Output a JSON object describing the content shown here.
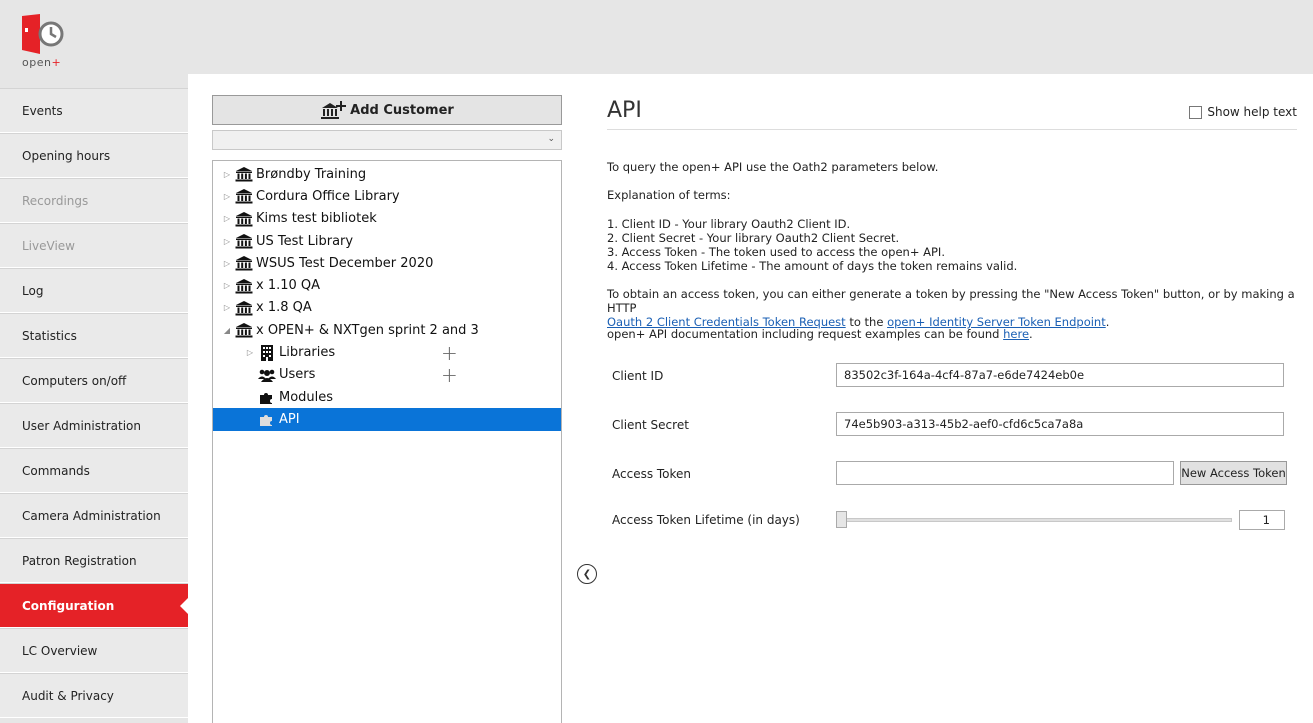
{
  "logo": {
    "text": "open",
    "accent": "+",
    "brand_color": "#e52227"
  },
  "sidebar": {
    "items": [
      {
        "label": "Events",
        "state": "normal"
      },
      {
        "label": "Opening hours",
        "state": "normal"
      },
      {
        "label": "Recordings",
        "state": "disabled"
      },
      {
        "label": "LiveView",
        "state": "disabled"
      },
      {
        "label": "Log",
        "state": "normal"
      },
      {
        "label": "Statistics",
        "state": "normal"
      },
      {
        "label": "Computers on/off",
        "state": "normal"
      },
      {
        "label": "User Administration",
        "state": "normal"
      },
      {
        "label": "Commands",
        "state": "normal"
      },
      {
        "label": "Camera Administration",
        "state": "normal"
      },
      {
        "label": "Patron Registration",
        "state": "normal"
      },
      {
        "label": "Configuration",
        "state": "active"
      },
      {
        "label": "LC Overview",
        "state": "normal"
      },
      {
        "label": "Audit & Privacy",
        "state": "normal"
      }
    ]
  },
  "tree_panel": {
    "add_customer_label": "Add Customer",
    "customers": [
      {
        "label": "Brøndby Training"
      },
      {
        "label": "Cordura Office Library"
      },
      {
        "label": "Kims test bibliotek"
      },
      {
        "label": "US Test Library"
      },
      {
        "label": "WSUS Test December 2020"
      },
      {
        "label": "x 1.10 QA"
      },
      {
        "label": "x 1.8 QA"
      },
      {
        "label": "x OPEN+ & NXTgen sprint 2 and 3"
      }
    ],
    "children": [
      {
        "label": "Libraries",
        "icon": "building-icon"
      },
      {
        "label": "Users",
        "icon": "users-icon"
      },
      {
        "label": "Modules",
        "icon": "puzzle-icon"
      },
      {
        "label": "API",
        "icon": "puzzle-icon"
      }
    ]
  },
  "content": {
    "title": "API",
    "show_help_label": "Show help text",
    "intro": "To query the open+ API use the Oath2 parameters below.",
    "explanation_heading": "Explanation of terms:",
    "terms": [
      "1. Client ID - Your library Oauth2 Client ID.",
      "2. Client Secret - Your library Oauth2 Client Secret.",
      "3. Access Token - The token used to access the open+ API.",
      "4. Access Token Lifetime - The amount of days the token remains valid."
    ],
    "obtain_text_1": "To obtain an access token, you can either generate a token by pressing the \"New Access Token\" button, or by making a HTTP",
    "obtain_link_1": "Oauth 2 Client Credentials Token Request",
    "obtain_text_2": " to the ",
    "obtain_link_2": "open+ Identity Server Token Endpoint",
    "obtain_text_3": ".",
    "docs_text": "open+ API documentation including request examples can be found ",
    "docs_link": "here",
    "docs_end": ".",
    "fields": {
      "client_id_label": "Client ID",
      "client_id_value": "83502c3f-164a-4cf4-87a7-e6de7424eb0e",
      "client_secret_label": "Client Secret",
      "client_secret_value": "74e5b903-a313-45b2-aef0-cfd6c5ca7a8a",
      "access_token_label": "Access Token",
      "access_token_value": "",
      "new_token_label": "New Access Token",
      "lifetime_label": "Access Token Lifetime (in days)",
      "lifetime_value": "1"
    }
  }
}
